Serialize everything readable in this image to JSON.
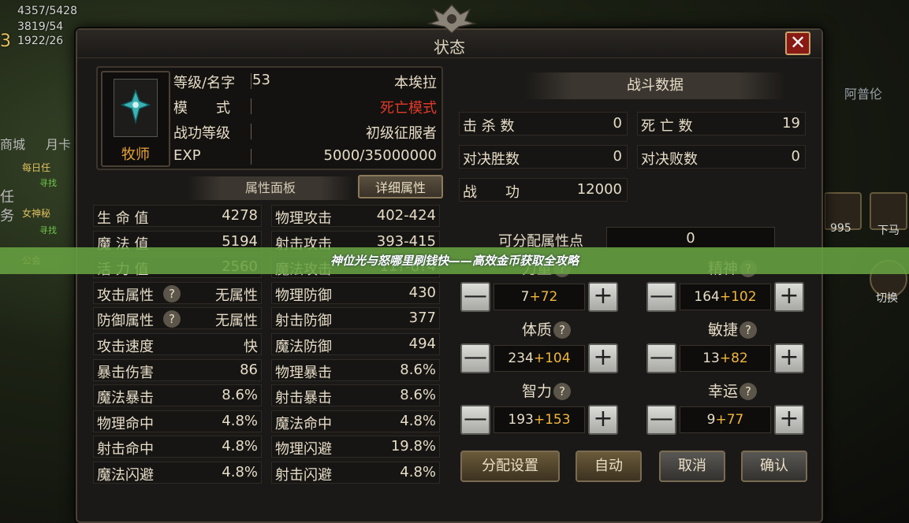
{
  "hud": {
    "stats": [
      "4357/5428",
      "3819/54",
      "1922/26"
    ],
    "level_digit": "3",
    "left_labels": [
      "商城",
      "月卡",
      "任",
      "务"
    ],
    "quests": [
      {
        "title": "每日任",
        "sub": "寻找"
      },
      {
        "title": "女神秘",
        "sub": "寻找"
      },
      {
        "title": "公会",
        "sub": ""
      }
    ],
    "right_labels": [
      "阿普伦",
      "995",
      "下马",
      "切换"
    ]
  },
  "window": {
    "title": "状态",
    "close_label": "✕"
  },
  "profile": {
    "class_name": "牧师",
    "rows": [
      {
        "label": "等级/名字",
        "left": "53",
        "value": "本埃拉",
        "red": false
      },
      {
        "label": "模　　式",
        "left": "",
        "value": "死亡模式",
        "red": true
      },
      {
        "label": "战功等级",
        "left": "",
        "value": "初级征服者",
        "red": false
      },
      {
        "label": "EXP",
        "left": "",
        "value": "5000/35000000",
        "red": false
      }
    ]
  },
  "tabs": {
    "panel": "属性面板",
    "detail": "详细属性"
  },
  "attributes": {
    "left": [
      {
        "k": "生 命 值",
        "v": "4278",
        "help": false
      },
      {
        "k": "魔 法 值",
        "v": "5194",
        "help": false
      },
      {
        "k": "活 力 值",
        "v": "2560",
        "help": false
      },
      {
        "k": "攻击属性",
        "v": "无属性",
        "help": true
      },
      {
        "k": "防御属性",
        "v": "无属性",
        "help": true
      },
      {
        "k": "攻击速度",
        "v": "快",
        "help": false
      },
      {
        "k": "暴击伤害",
        "v": "86",
        "help": false
      },
      {
        "k": "魔法暴击",
        "v": "8.6%",
        "help": false
      },
      {
        "k": "物理命中",
        "v": "4.8%",
        "help": false
      },
      {
        "k": "射击命中",
        "v": "4.8%",
        "help": false
      },
      {
        "k": "魔法闪避",
        "v": "4.8%",
        "help": false
      }
    ],
    "right": [
      {
        "k": "物理攻击",
        "v": "402-424"
      },
      {
        "k": "射击攻击",
        "v": "393-415"
      },
      {
        "k": "魔法攻击",
        "v": "11?-6?4"
      },
      {
        "k": "物理防御",
        "v": "430"
      },
      {
        "k": "射击防御",
        "v": "377"
      },
      {
        "k": "魔法防御",
        "v": "494"
      },
      {
        "k": "物理暴击",
        "v": "8.6%"
      },
      {
        "k": "射击暴击",
        "v": "8.6%"
      },
      {
        "k": "魔法命中",
        "v": "4.8%"
      },
      {
        "k": "物理闪避",
        "v": "19.8%"
      },
      {
        "k": "射击闪避",
        "v": "4.8%"
      }
    ]
  },
  "battle": {
    "title": "战斗数据",
    "items": [
      {
        "k": "击 杀 数",
        "v": "0"
      },
      {
        "k": "死 亡 数",
        "v": "19"
      },
      {
        "k": "对决胜数",
        "v": "0"
      },
      {
        "k": "对决败数",
        "v": "0"
      },
      {
        "k": "战　　功",
        "v": "12000"
      }
    ]
  },
  "allocation": {
    "label": "可分配属性点",
    "points": "0",
    "stats": [
      {
        "name": "力量",
        "base": "7",
        "add": "+72"
      },
      {
        "name": "精神",
        "base": "164",
        "add": "+102"
      },
      {
        "name": "体质",
        "base": "234",
        "add": "+104"
      },
      {
        "name": "敏捷",
        "base": "13",
        "add": "+82"
      },
      {
        "name": "智力",
        "base": "193",
        "add": "+153"
      },
      {
        "name": "幸运",
        "base": "9",
        "add": "+77"
      }
    ],
    "help_glyph": "?",
    "minus": "—",
    "plus": "+"
  },
  "footer": {
    "assign": "分配设置",
    "auto": "自动",
    "cancel": "取消",
    "confirm": "确认"
  },
  "banner": {
    "text": "神位光与怒哪里刷钱快——高效金币获取全攻略"
  },
  "colors": {
    "red": "#e23a2a",
    "gold": "#f0b63a",
    "class": "#e8a23a",
    "banner": "#68a242"
  }
}
